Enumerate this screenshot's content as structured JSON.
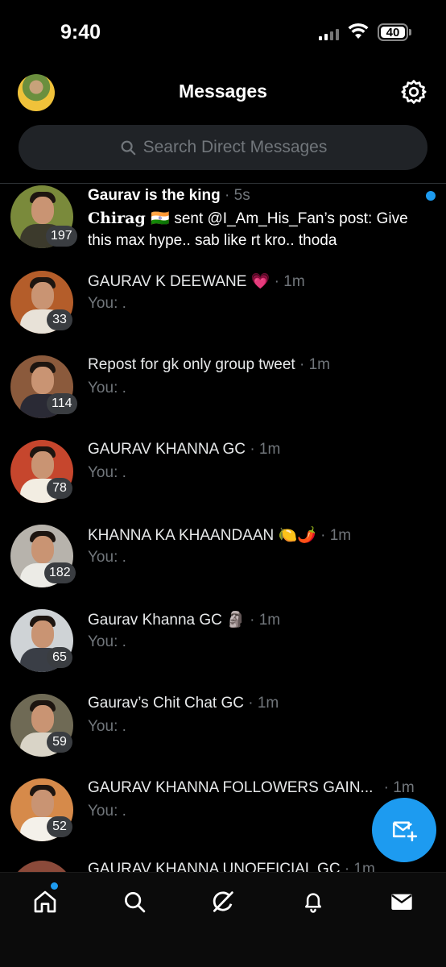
{
  "status_bar": {
    "time": "9:40",
    "battery": "40"
  },
  "header": {
    "title": "Messages"
  },
  "search": {
    "placeholder": "Search Direct Messages"
  },
  "conversations": [
    {
      "name": "Gaurav is the king",
      "time": "· 5s",
      "sender": "Chirag 🇮🇳",
      "preview": "sent @I_Am_His_Fan’s post: Give this max hype.. sab like rt kro.. thoda",
      "count": "197",
      "unread": true,
      "avatar_color": "#7a8a3b"
    },
    {
      "name": "GAURAV K DEEWANE 💗",
      "time": "· 1m",
      "preview": "You: .",
      "count": "33",
      "avatar_color": "#b45d2a"
    },
    {
      "name": "Repost for gk only group tweet",
      "time": "· 1m",
      "preview": "You: .",
      "count": "114",
      "avatar_color": "#8b5a3c"
    },
    {
      "name": "GAURAV KHANNA GC",
      "time": "· 1m",
      "preview": "You: .",
      "count": "78",
      "avatar_color": "#c6462d"
    },
    {
      "name": "KHANNA KA KHAANDAAN 🍋🌶️",
      "time": "· 1m",
      "preview": "You: .",
      "count": "182",
      "avatar_color": "#b7b3ac"
    },
    {
      "name": "Gaurav Khanna GC 🗿",
      "time": "· 1m",
      "preview": "You: .",
      "count": "65",
      "avatar_color": "#cfd3d6"
    },
    {
      "name": "Gaurav’s Chit Chat GC",
      "time": "· 1m",
      "preview": "You: .",
      "count": "59",
      "avatar_color": "#6f6a55"
    },
    {
      "name": "GAURAV KHANNA FOLLOWERS GAIN...",
      "time": "· 1m",
      "preview": "You: .",
      "count": "52",
      "avatar_color": "#d68a4a"
    },
    {
      "name": "GAURAV KHANNA UNOFFICIAL GC",
      "time": "· 1m",
      "preview": "",
      "count": "",
      "avatar_color": "#8b4a3a"
    }
  ],
  "nav": {
    "items": [
      "home-icon",
      "search-icon",
      "grok-icon",
      "notifications-icon",
      "messages-icon"
    ]
  },
  "colors": {
    "accent": "#1d9bf0",
    "background": "#000000",
    "muted": "#71767b"
  }
}
